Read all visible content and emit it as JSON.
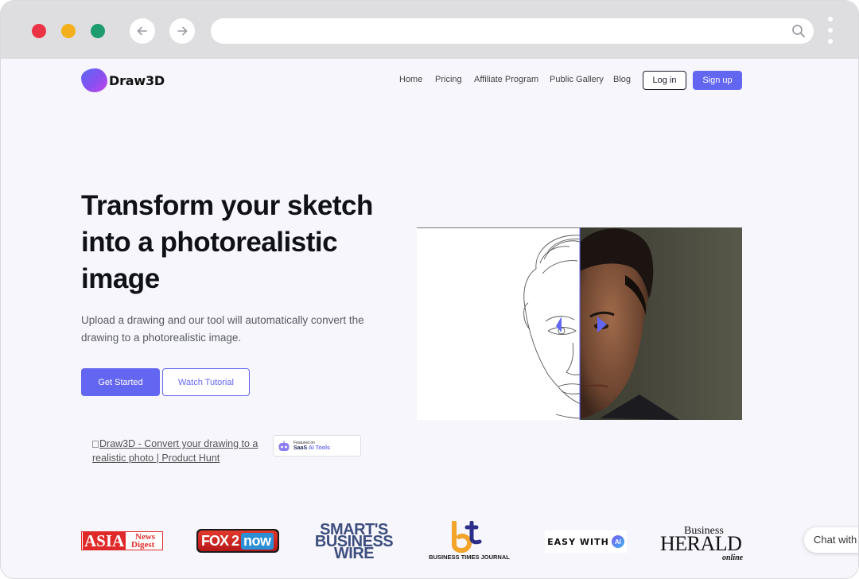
{
  "browser": {
    "back_icon": "arrow-left-icon",
    "forward_icon": "arrow-right-icon",
    "search_icon": "search-icon",
    "url": ""
  },
  "brand": {
    "name": "Draw3D",
    "accent": "#6366f1"
  },
  "nav": {
    "items": [
      {
        "label": "Home"
      },
      {
        "label": "Pricing"
      },
      {
        "label": "Affiliate Program"
      },
      {
        "label": "Public Gallery"
      },
      {
        "label": "Blog"
      }
    ],
    "login_label": "Log in",
    "signup_label": "Sign up"
  },
  "hero": {
    "headline": "Transform your sketch into a photorealistic image",
    "subtext": "Upload a drawing and our tool will automatically convert the drawing to a photorealistic image.",
    "get_started_label": "Get Started",
    "watch_tutorial_label": "Watch Tutorial",
    "product_hunt_alt": "Draw3D - Convert your drawing to a realistic photo | Product Hunt",
    "saas_badge": {
      "line1": "Featured on",
      "brand_a": "SaaS",
      "brand_b": "AI Tools"
    }
  },
  "press": {
    "asia": {
      "main": "ASIA",
      "top": "News",
      "bottom": "Digest"
    },
    "fox": {
      "a": "FOX 2",
      "b": "now"
    },
    "smarts": {
      "line1": "SMART'S",
      "line2": "BUSINESS",
      "line3": "WIRE"
    },
    "btj": {
      "name": "BUSINESS TIMES JOURNAL"
    },
    "easy": {
      "text": "EASY WITH",
      "badge": "AI"
    },
    "herald": {
      "line1": "Business",
      "line2": "HERALD",
      "line3": "online"
    }
  },
  "chat": {
    "label": "Chat with us"
  }
}
